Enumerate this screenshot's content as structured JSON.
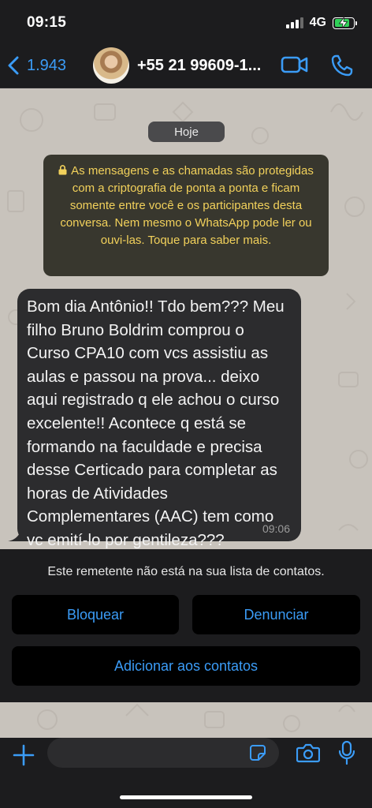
{
  "status_bar": {
    "time": "09:15",
    "network": "4G",
    "battery_level": 0.8
  },
  "header": {
    "back_label": "1.943",
    "contact_name": "+55 21 99609-1...",
    "icons": {
      "back": "chevron-left-icon",
      "video": "video-camera-icon",
      "phone": "phone-icon"
    }
  },
  "chat": {
    "date_label": "Hoje",
    "encryption_notice": "As mensagens e as chamadas são protegidas com a criptografia de ponta a ponta e ficam somente entre você e os participantes desta conversa. Nem mesmo o WhatsApp pode ler ou ouvi-las. Toque para saber mais.",
    "messages": [
      {
        "text": "Bom dia Antônio!! Tdo bem??? Meu filho Bruno Boldrim comprou o Curso CPA10 com vcs assistiu as aulas e passou na prova... deixo aqui registrado q ele achou o curso excelente!! Acontece q está se formando na faculdade e precisa desse Certicado para completar as horas de Atividades Complementares (AAC) tem como vc emití-lo por gentileza???",
        "time": "09:06"
      }
    ]
  },
  "unknown_sender": {
    "notice": "Este remetente não está na sua lista de contatos.",
    "block_label": "Bloquear",
    "report_label": "Denunciar",
    "add_contact_label": "Adicionar aos contatos"
  },
  "composer": {
    "placeholder": "",
    "icons": {
      "plus": "plus-icon",
      "sticker": "sticker-icon",
      "camera": "camera-icon",
      "mic": "microphone-icon"
    }
  },
  "colors": {
    "accent": "#3b9cf7",
    "notice_text": "#f2d15b",
    "battery": "#30d158",
    "chat_background": "#c8c3bc"
  }
}
